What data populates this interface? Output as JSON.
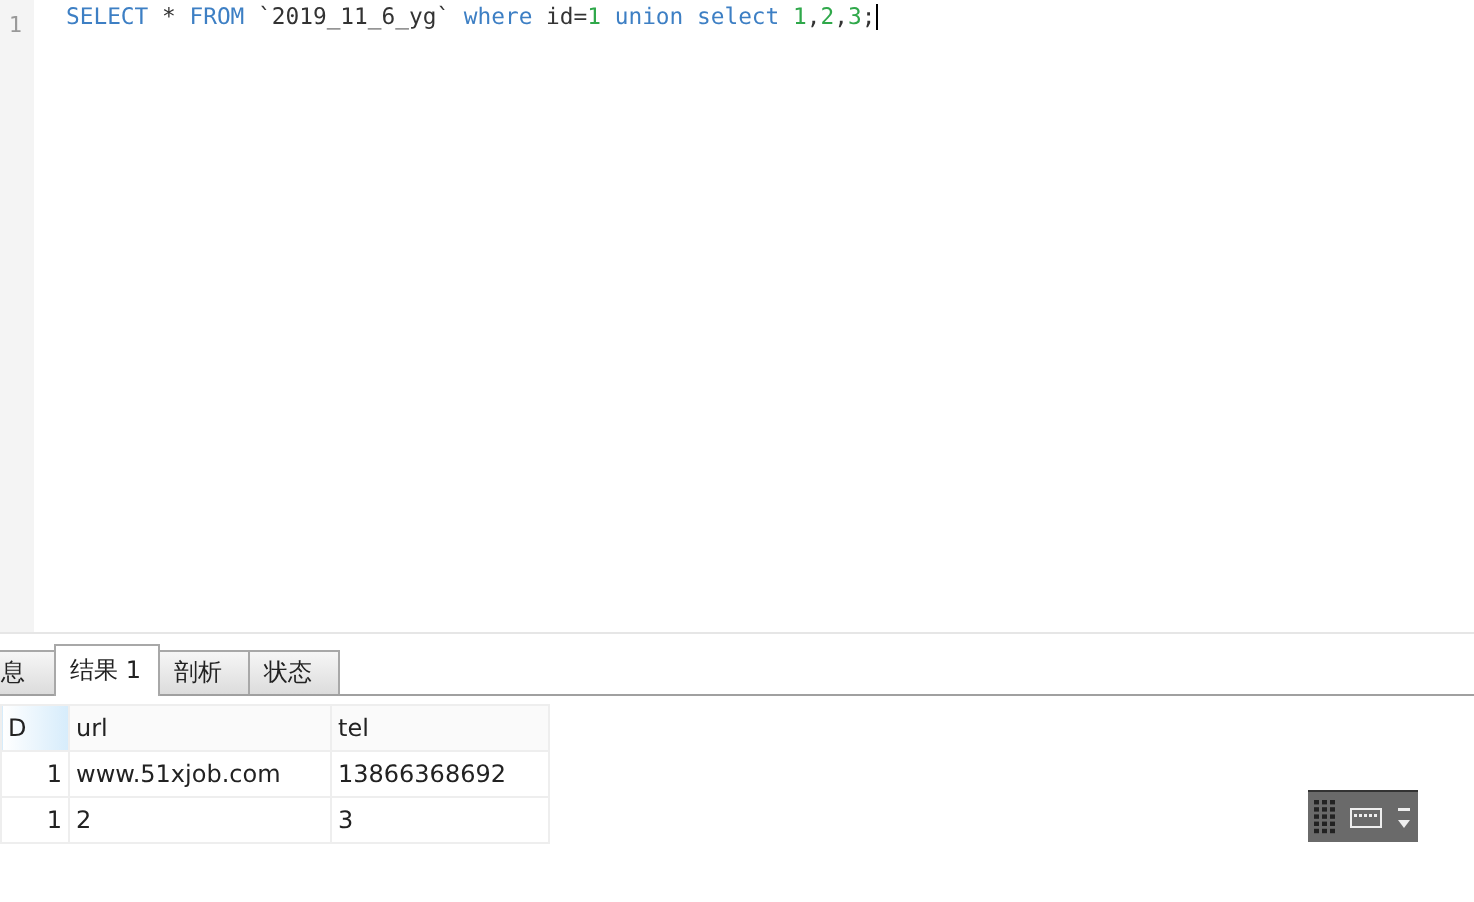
{
  "editor": {
    "line_number": "1",
    "tokens": [
      {
        "text": "SELECT",
        "kind": "keyword"
      },
      {
        "text": " * ",
        "kind": "plain"
      },
      {
        "text": "FROM",
        "kind": "keyword"
      },
      {
        "text": " `2019_11_6_yg` ",
        "kind": "plain"
      },
      {
        "text": "where",
        "kind": "keyword"
      },
      {
        "text": " id=",
        "kind": "plain"
      },
      {
        "text": "1",
        "kind": "number"
      },
      {
        "text": " union select ",
        "kind": "keyword"
      },
      {
        "text": "1",
        "kind": "number"
      },
      {
        "text": ",",
        "kind": "plain"
      },
      {
        "text": "2",
        "kind": "number"
      },
      {
        "text": ",",
        "kind": "plain"
      },
      {
        "text": "3",
        "kind": "number"
      },
      {
        "text": ";",
        "kind": "plain"
      }
    ]
  },
  "tabs": [
    {
      "label": "息",
      "selected": false
    },
    {
      "label": "结果 1",
      "selected": true
    },
    {
      "label": "剖析",
      "selected": false
    },
    {
      "label": "状态",
      "selected": false
    }
  ],
  "table": {
    "columns": [
      {
        "label": "D",
        "selected": true
      },
      {
        "label": "url",
        "selected": false
      },
      {
        "label": "tel",
        "selected": false
      }
    ],
    "rows": [
      [
        "1",
        "www.51xjob.com",
        "13866368692"
      ],
      [
        "1",
        "2",
        "3"
      ]
    ]
  }
}
